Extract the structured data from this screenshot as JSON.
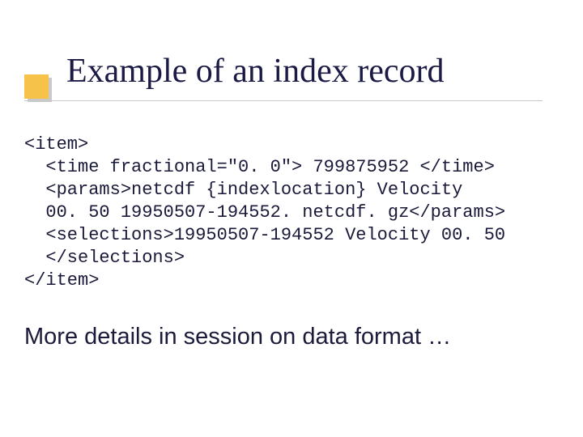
{
  "slide": {
    "title": "Example of an index record",
    "code_lines": {
      "l0": "<item>",
      "l1": "  <time fractional=\"0. 0\"> 799875952 </time>",
      "l2": "  <params>netcdf {indexlocation} Velocity",
      "l3": "  00. 50 19950507-194552. netcdf. gz</params>",
      "l4": "  <selections>19950507-194552 Velocity 00. 50",
      "l5": "  </selections>",
      "l6": "</item>"
    },
    "footer": "More details in session on data format …"
  }
}
